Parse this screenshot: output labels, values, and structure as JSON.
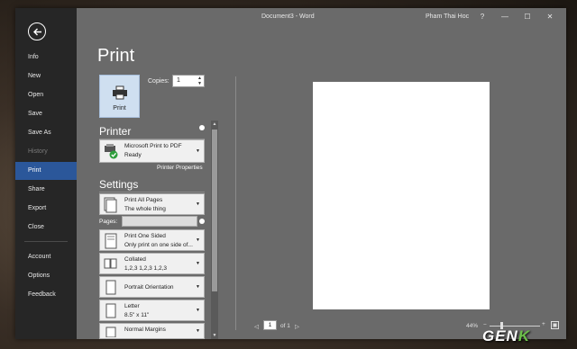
{
  "window": {
    "title": "Document3 - Word",
    "user": "Pham Thai Hoc"
  },
  "titlebar_buttons": {
    "help": "?",
    "minimize": "—",
    "restore": "☐",
    "close": "✕"
  },
  "nav": {
    "items": [
      {
        "label": "Info",
        "state": "normal"
      },
      {
        "label": "New",
        "state": "normal"
      },
      {
        "label": "Open",
        "state": "normal"
      },
      {
        "label": "Save",
        "state": "normal"
      },
      {
        "label": "Save As",
        "state": "normal"
      },
      {
        "label": "History",
        "state": "disabled"
      },
      {
        "label": "Print",
        "state": "active"
      },
      {
        "label": "Share",
        "state": "normal"
      },
      {
        "label": "Export",
        "state": "normal"
      },
      {
        "label": "Close",
        "state": "normal"
      },
      {
        "label": "Account",
        "state": "normal"
      },
      {
        "label": "Options",
        "state": "normal"
      },
      {
        "label": "Feedback",
        "state": "normal"
      }
    ]
  },
  "print": {
    "title": "Print",
    "button_label": "Print",
    "copies_label": "Copies:",
    "copies_value": "1"
  },
  "printer": {
    "heading": "Printer",
    "name": "Microsoft Print to PDF",
    "status": "Ready",
    "properties_link": "Printer Properties"
  },
  "settings": {
    "heading": "Settings",
    "pages_label": "Pages:",
    "pages_value": "",
    "options": [
      {
        "title": "Print All Pages",
        "subtitle": "The whole thing",
        "icon": "print-pages-icon"
      },
      {
        "title": "Print One Sided",
        "subtitle": "Only print on one side of...",
        "icon": "one-sided-icon"
      },
      {
        "title": "Collated",
        "subtitle": "1,2,3    1,2,3    1,2,3",
        "icon": "collated-icon"
      },
      {
        "title": "Portrait Orientation",
        "subtitle": "",
        "icon": "portrait-icon"
      },
      {
        "title": "Letter",
        "subtitle": "8.5\" x 11\"",
        "icon": "letter-icon"
      },
      {
        "title": "Normal Margins",
        "subtitle": "",
        "icon": "margins-icon"
      }
    ]
  },
  "preview": {
    "current_page": "1",
    "of_label": "of 1",
    "zoom": "44%",
    "zoom_fraction": 0.44
  },
  "watermark": {
    "text": "GEN",
    "accent": "K"
  },
  "colors": {
    "accent": "#2b579a",
    "nav_bg": "#262626",
    "backstage_bg": "#6a6a6a",
    "print_button_bg": "#cfdff0"
  }
}
